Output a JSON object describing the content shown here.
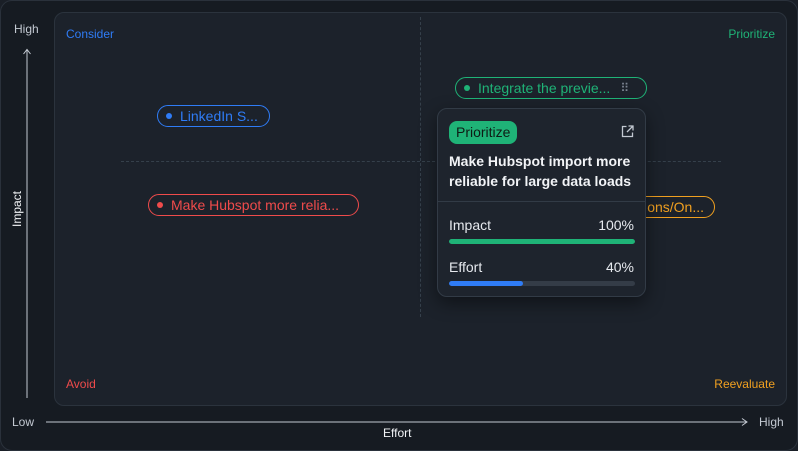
{
  "axes": {
    "y_high": "High",
    "y_label": "Impact",
    "x_low": "Low",
    "x_label": "Effort",
    "x_high": "High"
  },
  "quadrants": {
    "consider": "Consider",
    "prioritize": "Prioritize",
    "avoid": "Avoid",
    "reevaluate": "Reevaluate"
  },
  "items": {
    "linkedin": {
      "label": "LinkedIn S...",
      "color": "#2f7cf6"
    },
    "integrate": {
      "label": "Integrate the previe...",
      "color": "#1fb377"
    },
    "hubspot": {
      "label": "Make Hubspot more relia...",
      "color": "#ef4b4b"
    },
    "ons": {
      "label": "ons/On...",
      "color": "#f0a020"
    }
  },
  "card": {
    "badge": "Prioritize",
    "title": "Make Hubspot import more reliable for large data loads",
    "impact_label": "Impact",
    "impact_value": "100%",
    "impact_fraction": 1.0,
    "effort_label": "Effort",
    "effort_value": "40%",
    "effort_fraction": 0.4
  },
  "colors": {
    "prioritize": "#1fb377",
    "consider": "#2f7cf6",
    "avoid": "#ef4b4b",
    "reevaluate": "#f0a020"
  },
  "icons": [
    "external-link-icon",
    "drag-handle-icon",
    "arrow-up-icon",
    "arrow-right-icon"
  ]
}
